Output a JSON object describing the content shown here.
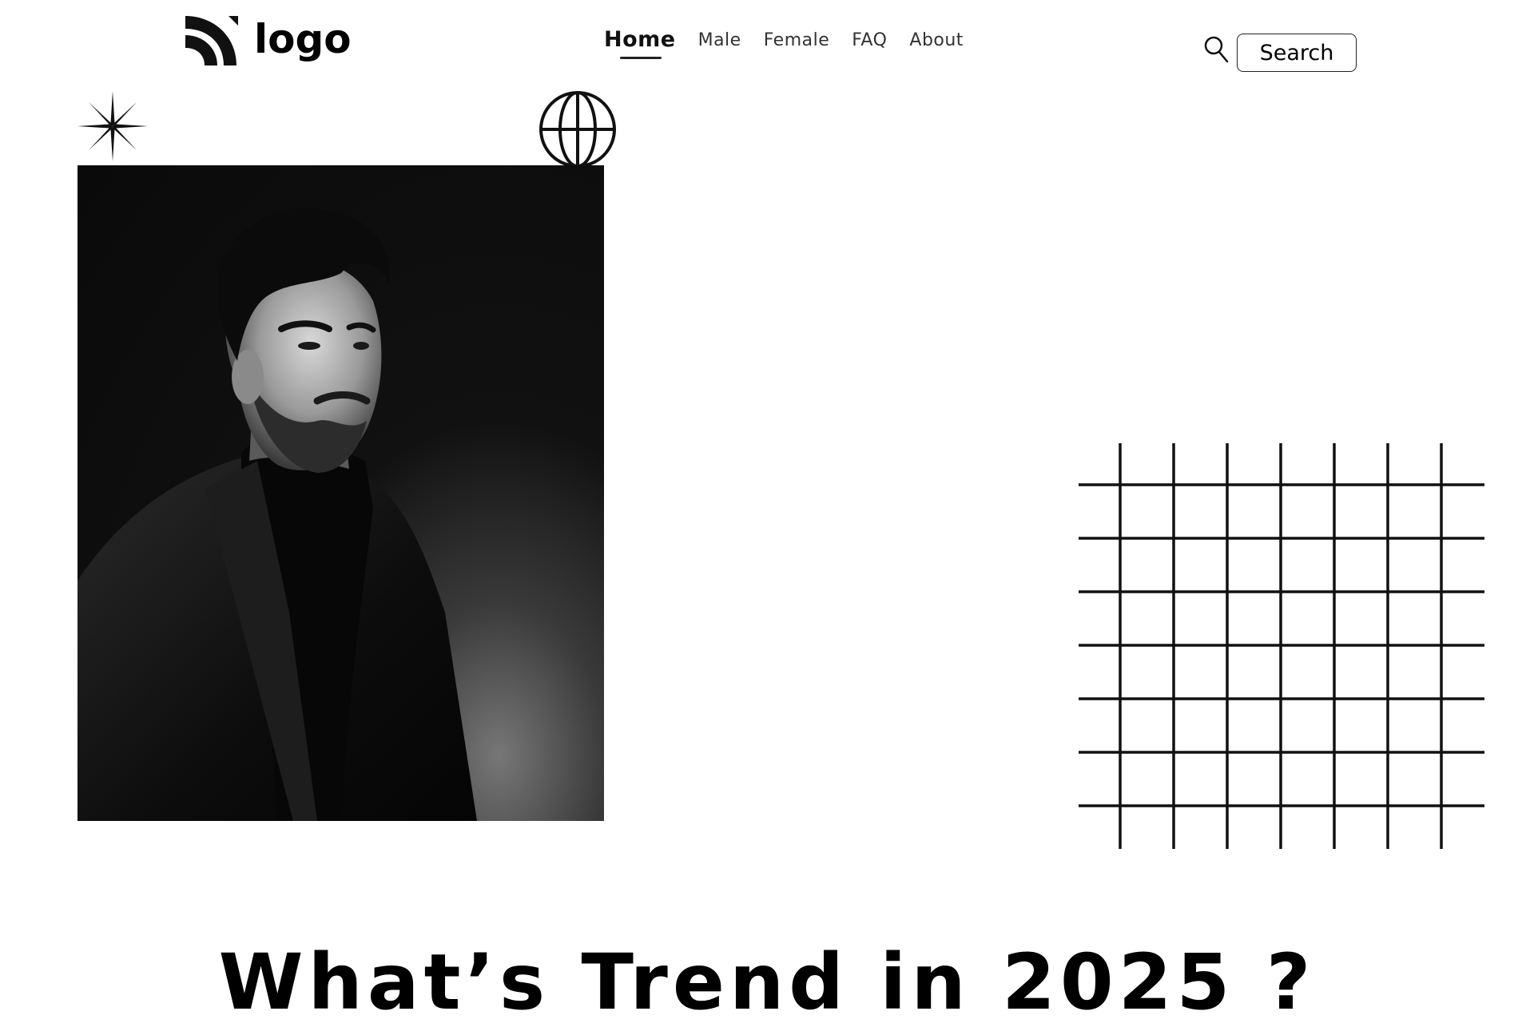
{
  "header": {
    "logo_text": "logo",
    "nav": [
      {
        "label": "Home",
        "active": true
      },
      {
        "label": "Male",
        "active": false
      },
      {
        "label": "Female",
        "active": false
      },
      {
        "label": "FAQ",
        "active": false
      },
      {
        "label": "About",
        "active": false
      }
    ],
    "search_label": "Search"
  },
  "hero": {
    "headline": "What’s Trend in 2025 ?"
  },
  "icons": {
    "logo": "logo-mark-icon",
    "search": "search-icon",
    "sparkle": "sparkle-icon",
    "globe": "globe-icon",
    "grid": "grid-pattern-icon"
  }
}
